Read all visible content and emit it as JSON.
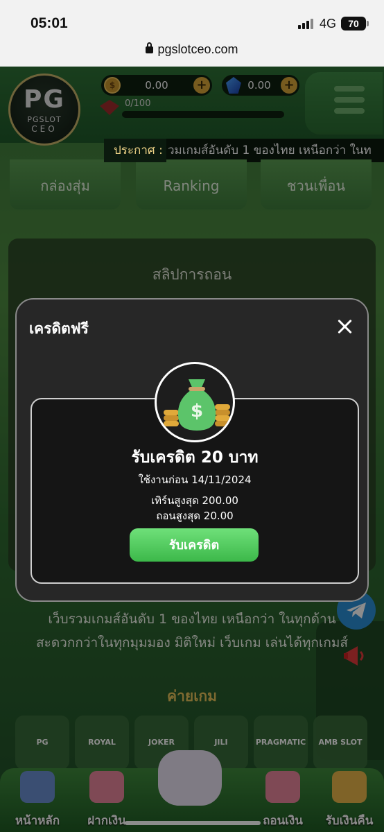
{
  "status_bar": {
    "time": "05:01",
    "network": "4G",
    "battery": "70"
  },
  "browser": {
    "url": "pgslotceo.com"
  },
  "header": {
    "logo": {
      "main": "PG",
      "sub": "PGSLOT",
      "ceo": "CEO"
    },
    "coin_balance": "0.00",
    "gem_balance": "0.00",
    "xp": "0/100",
    "announce_label": "ประกาศ :",
    "announce_text": "วมเกมส์อันดับ 1 ของไทย เหนือกว่า ในท"
  },
  "quick_tiles": [
    "กล่องสุ่ม",
    "Ranking",
    "ชวนเพื่อน"
  ],
  "slip_panel": {
    "title": "สลิปการถอน"
  },
  "intro": {
    "line1": "เว็บรวมเกมส์อันดับ 1 ของไทย เหนือกว่า ในทุกด้าน",
    "line2": "สะดวกกว่าในทุกมุมมอง มิติใหม่ เว็บเกม เล่นได้ทุกเกมส์"
  },
  "providers_title": "ค่ายเกม",
  "providers": [
    "PG",
    "ROYAL",
    "JOKER",
    "JILI",
    "PRAGMATIC PLAY",
    "AMB SLOT"
  ],
  "bottom_nav": [
    "หน้าหลัก",
    "ฝากเงิน",
    "ถอนเงิน",
    "รับเงินคืน"
  ],
  "modal": {
    "title": "เครดิตฟรี",
    "reward_title": "รับเครดิต 20 บาท",
    "expire": "ใช้งานก่อน 14/11/2024",
    "max_turnover": "เทิร์นสูงสุด 200.00",
    "max_withdraw": "ถอนสูงสุด 20.00",
    "claim_label": "รับเครดิต"
  },
  "colors": {
    "accent": "#3cb84a",
    "gold": "#e8c25a",
    "modal_bg": "#272727"
  }
}
